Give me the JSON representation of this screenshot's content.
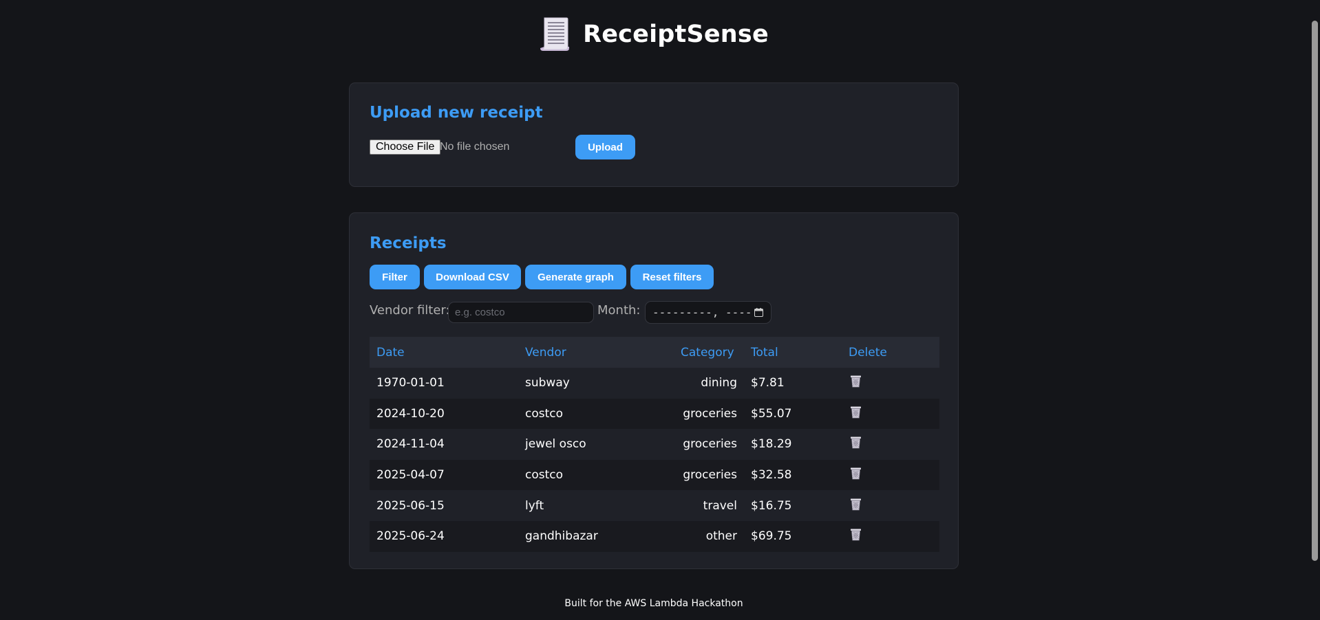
{
  "header": {
    "app_title": "ReceiptSense",
    "icon": "receipt-icon"
  },
  "upload": {
    "section_title": "Upload new receipt",
    "choose_file_label": "Choose File",
    "file_status": "No file chosen",
    "upload_label": "Upload"
  },
  "receipts": {
    "section_title": "Receipts",
    "toolbar": {
      "filter_label": "Filter",
      "download_csv_label": "Download CSV",
      "generate_graph_label": "Generate graph",
      "reset_filters_label": "Reset filters"
    },
    "filters": {
      "vendor_label": "Vendor filter:",
      "vendor_placeholder": "e.g. costco",
      "vendor_value": "",
      "month_label": "Month:",
      "month_value": "---------, ----"
    },
    "columns": {
      "date": "Date",
      "vendor": "Vendor",
      "category": "Category",
      "total": "Total",
      "delete": "Delete"
    },
    "rows": [
      {
        "date": "1970-01-01",
        "vendor": "subway",
        "category": "dining",
        "total": "$7.81"
      },
      {
        "date": "2024-10-20",
        "vendor": "costco",
        "category": "groceries",
        "total": "$55.07"
      },
      {
        "date": "2024-11-04",
        "vendor": "jewel osco",
        "category": "groceries",
        "total": "$18.29"
      },
      {
        "date": "2025-04-07",
        "vendor": "costco",
        "category": "groceries",
        "total": "$32.58"
      },
      {
        "date": "2025-06-15",
        "vendor": "lyft",
        "category": "travel",
        "total": "$16.75"
      },
      {
        "date": "2025-06-24",
        "vendor": "gandhibazar",
        "category": "other",
        "total": "$69.75"
      }
    ],
    "delete_icon": "trash-icon"
  },
  "footer": {
    "text": "Built for the AWS Lambda Hackathon"
  },
  "colors": {
    "accent": "#3d9cf5",
    "background": "#141519",
    "card": "#1f2128"
  }
}
